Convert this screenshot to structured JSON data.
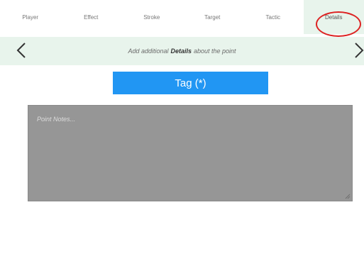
{
  "tabs": [
    {
      "label": "Player"
    },
    {
      "label": "Effect"
    },
    {
      "label": "Stroke"
    },
    {
      "label": "Target"
    },
    {
      "label": "Tactic"
    },
    {
      "label": "Details",
      "active": true
    }
  ],
  "subheader": {
    "prefix": "Add additional",
    "emphasis": "Details",
    "suffix": "about the point"
  },
  "tag_button": {
    "label": "Tag (*)"
  },
  "notes": {
    "placeholder": "Point Notes...",
    "value": ""
  },
  "colors": {
    "accent": "#2196f3",
    "tab_active_bg": "#e8f4ec",
    "subheader_bg": "#e8f4ec",
    "notes_bg": "#969696",
    "highlight_ring": "#dd2222"
  },
  "icons": {
    "prev": "chevron-left-icon",
    "next": "chevron-right-icon"
  }
}
